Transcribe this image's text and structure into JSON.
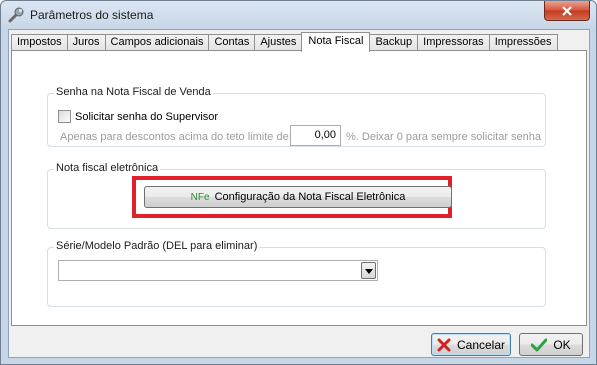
{
  "window": {
    "title": "Parâmetros do sistema",
    "close_icon": "close-icon"
  },
  "tabs": [
    {
      "label": "Impostos",
      "active": false
    },
    {
      "label": "Juros",
      "active": false
    },
    {
      "label": "Campos adicionais",
      "active": false
    },
    {
      "label": "Contas",
      "active": false
    },
    {
      "label": "Ajustes",
      "active": false
    },
    {
      "label": "Nota Fiscal",
      "active": true
    },
    {
      "label": "Backup",
      "active": false
    },
    {
      "label": "Impressoras",
      "active": false
    },
    {
      "label": "Impressões",
      "active": false
    }
  ],
  "senha_group": {
    "title": "Senha na Nota Fiscal de Venda",
    "checkbox_label": "Solicitar senha do Supervisor",
    "checked": false,
    "hint_prefix": "Apenas para descontos acima do teto limite de:",
    "value": "0,00",
    "hint_suffix": "%. Deixar 0 para sempre solicitar senha"
  },
  "nfe_group": {
    "title": "Nota fiscal eletrônica",
    "button_icon_text": "NFe",
    "button_label": "Configuração da Nota Fiscal Eletrônica",
    "highlight_color": "#e0202a"
  },
  "serie_group": {
    "title": "Série/Modelo Padrão (DEL para eliminar)",
    "selected_value": ""
  },
  "footer": {
    "cancel_label": "Cancelar",
    "ok_label": "OK",
    "cancel_icon": "x-icon",
    "ok_icon": "checkmark-icon"
  }
}
